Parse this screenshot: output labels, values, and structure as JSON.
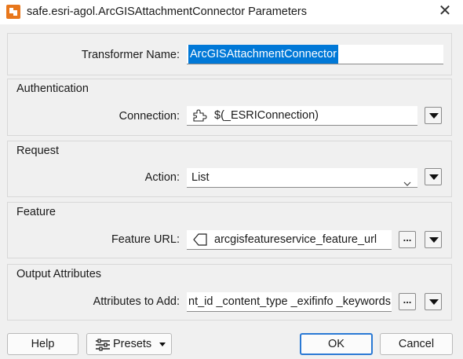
{
  "window": {
    "title": "safe.esri-agol.ArcGISAttachmentConnector Parameters",
    "close_glyph": "✕"
  },
  "transformer": {
    "label": "Transformer Name:",
    "value": "ArcGISAttachmentConnector"
  },
  "authentication": {
    "group_title": "Authentication",
    "connection_label": "Connection:",
    "connection_value": "$(_ESRIConnection)",
    "connection_icon": "puzzle-icon"
  },
  "request": {
    "group_title": "Request",
    "action_label": "Action:",
    "action_value": "List"
  },
  "feature": {
    "group_title": "Feature",
    "url_label": "Feature URL:",
    "url_value": "arcgisfeatureservice_feature_url",
    "url_icon": "attribute-value-icon"
  },
  "output": {
    "group_title": "Output Attributes",
    "attributes_label": "Attributes to Add:",
    "attributes_value": "nt_id _content_type _exifinfo _keywords"
  },
  "buttons": {
    "help": "Help",
    "presets": "Presets",
    "ok": "OK",
    "cancel": "Cancel",
    "ellipsis": "..."
  },
  "colors": {
    "accent": "#0078d7",
    "fme_orange": "#e8771c",
    "dialog_bg": "#f0f0f0"
  }
}
